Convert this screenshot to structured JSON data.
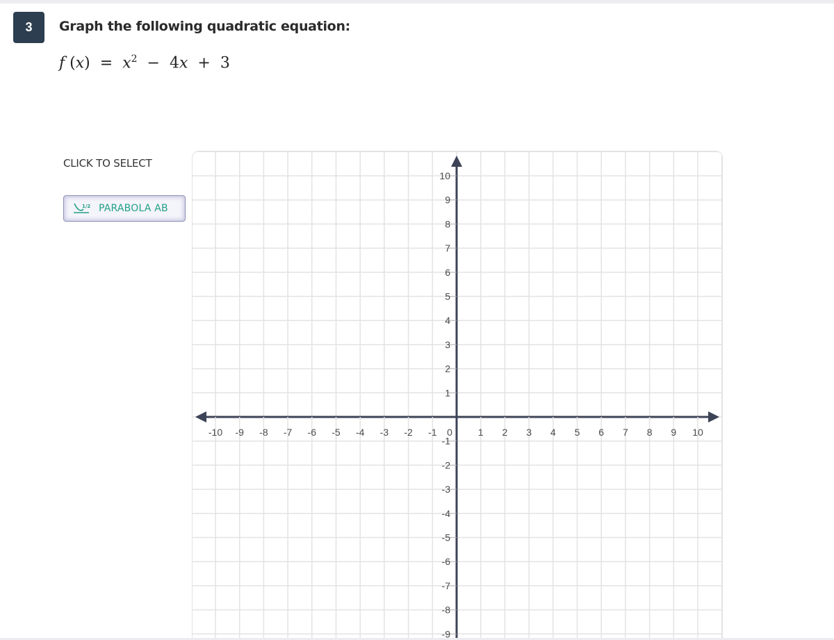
{
  "question": {
    "number": "3",
    "title": "Graph the following quadratic equation:",
    "equation": {
      "lhs_func": "f",
      "lhs_var": "x",
      "rhs": "x² − 4x + 3",
      "parts": [
        "f",
        "(",
        "x",
        ")",
        "=",
        "x",
        "2",
        "−",
        "4",
        "x",
        "+",
        "3"
      ]
    }
  },
  "toolbox": {
    "label": "CLICK TO SELECT",
    "tools": [
      {
        "label": "PARABOLA AB",
        "icon": "parabola-icon",
        "selected": true
      }
    ]
  },
  "graph": {
    "x_range": [
      -10,
      10
    ],
    "y_range": [
      -9,
      10
    ],
    "x_ticks": [
      "-10",
      "-9",
      "-8",
      "-7",
      "-6",
      "-5",
      "-4",
      "-3",
      "-2",
      "-1",
      "0",
      "1",
      "2",
      "3",
      "4",
      "5",
      "6",
      "7",
      "8",
      "9",
      "10"
    ],
    "y_ticks": [
      "10",
      "9",
      "8",
      "7",
      "6",
      "5",
      "4",
      "3",
      "2",
      "1",
      "-1",
      "-2",
      "-3",
      "-4",
      "-5",
      "-6",
      "-7",
      "-8",
      "-9"
    ],
    "colors": {
      "axis": "#3d4356",
      "grid": "#e3e3e3",
      "accent": "#21a085",
      "badge": "#2d3e50"
    }
  }
}
